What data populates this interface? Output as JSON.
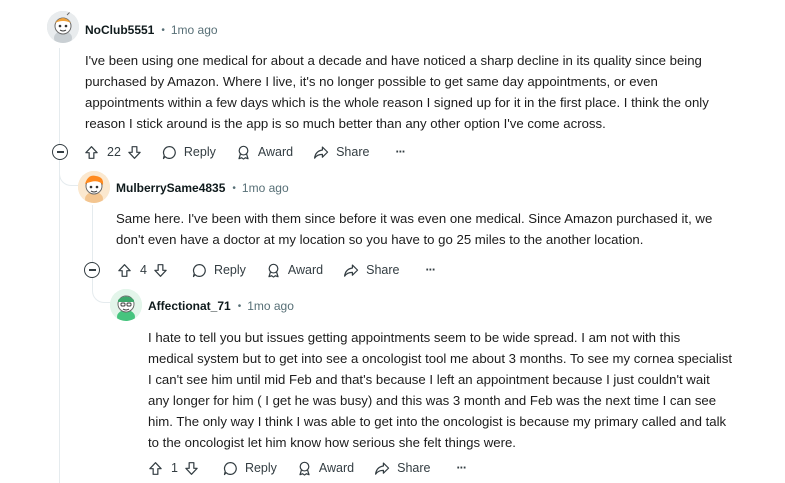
{
  "comments": [
    {
      "username": "NoClub5551",
      "age": "1mo ago",
      "body": [
        "I've been using one medical for about a decade and have noticed a sharp decline in its quality since being",
        "purchased by Amazon. Where I live, it's no longer possible to get same day appointments, or even",
        "appointments within a few days which is the whole reason I signed up for it in the first place. I think the only",
        "reason I stick around is the app is so much better than any other option I've come across."
      ],
      "score": "22",
      "reply_label": "Reply",
      "award_label": "Award",
      "share_label": "Share",
      "more_label": "···",
      "avatar_color": "#f0a23b"
    },
    {
      "username": "MulberrySame4835",
      "age": "1mo ago",
      "body": [
        "Same here. I've been with them since before it was even one medical. Since Amazon purchased it, we",
        "don't even have a doctor at my location so you have to go 25 miles to the another location."
      ],
      "score": "4",
      "reply_label": "Reply",
      "award_label": "Award",
      "share_label": "Share",
      "more_label": "···",
      "avatar_color": "#ff8a1f"
    },
    {
      "username": "Affectionat_71",
      "age": "1mo ago",
      "body": [
        "I hate to tell you but issues getting appointments seem to be wide spread. I am not with this",
        "medical system but to get into see a oncologist tool me about 3 months. To see my cornea specialist",
        "I can't see him until mid Feb and that's because I left an appointment because I just couldn't wait",
        "any longer for him ( I get he was busy) and this was 3 month and Feb was the next time I can see",
        "him. The only way I think I was able to get into the oncologist is because my primary called and talk",
        "to the oncologist let him know how serious she felt things were."
      ],
      "score": "1",
      "reply_label": "Reply",
      "award_label": "Award",
      "share_label": "Share",
      "more_label": "···",
      "avatar_color": "#46c47e"
    }
  ],
  "colors": {
    "text": "#1c1c1c",
    "meta": "#576f76",
    "icon": "#333d42",
    "thread_line": "#e5ebee"
  }
}
